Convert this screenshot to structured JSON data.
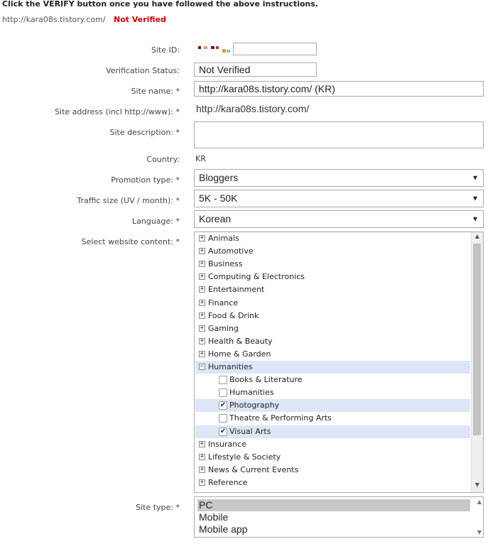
{
  "header": {
    "instruction": "Click the VERIFY button once you have followed the above instructions.",
    "site_url": "http://kara08s.tistory.com/",
    "status": "Not Verified"
  },
  "form": {
    "site_id": {
      "label": "Site ID:",
      "value": ""
    },
    "verification_status": {
      "label": "Verification Status:",
      "value": "Not Verified"
    },
    "site_name": {
      "label": "Site name: *",
      "value": "http://kara08s.tistory.com/ (KR)"
    },
    "site_address": {
      "label": "Site address (incl http://www):  *",
      "value": "http://kara08s.tistory.com/"
    },
    "site_description": {
      "label": "Site description: *",
      "value": ""
    },
    "country": {
      "label": "Country:",
      "value": "KR"
    },
    "promotion_type": {
      "label": "Promotion type: *",
      "value": "Bloggers"
    },
    "traffic_size": {
      "label": "Traffic size (UV / month): *",
      "value": "5K - 50K"
    },
    "language": {
      "label": "Language: *",
      "value": "Korean"
    },
    "website_content": {
      "label": "Select website content: *",
      "rows": [
        {
          "label": "Animals",
          "type": "group",
          "expanded": false
        },
        {
          "label": "Automotive",
          "type": "group",
          "expanded": false
        },
        {
          "label": "Business",
          "type": "group",
          "expanded": false
        },
        {
          "label": "Computing & Electronics",
          "type": "group",
          "expanded": false
        },
        {
          "label": "Entertainment",
          "type": "group",
          "expanded": false
        },
        {
          "label": "Finance",
          "type": "group",
          "expanded": false
        },
        {
          "label": "Food & Drink",
          "type": "group",
          "expanded": false
        },
        {
          "label": "Gaming",
          "type": "group",
          "expanded": false
        },
        {
          "label": "Health & Beauty",
          "type": "group",
          "expanded": false
        },
        {
          "label": "Home & Garden",
          "type": "group",
          "expanded": false
        },
        {
          "label": "Humanities",
          "type": "group",
          "expanded": true,
          "highlighted": true
        },
        {
          "label": "Books & Literature",
          "type": "item",
          "checked": false
        },
        {
          "label": "Humanities",
          "type": "item",
          "checked": false
        },
        {
          "label": "Photography",
          "type": "item",
          "checked": true,
          "highlighted": true
        },
        {
          "label": "Theatre & Performing Arts",
          "type": "item",
          "checked": false
        },
        {
          "label": "Visual Arts",
          "type": "item",
          "checked": true,
          "highlighted": true
        },
        {
          "label": "Insurance",
          "type": "group",
          "expanded": false
        },
        {
          "label": "Lifestyle & Society",
          "type": "group",
          "expanded": false
        },
        {
          "label": "News & Current Events",
          "type": "group",
          "expanded": false
        },
        {
          "label": "Reference",
          "type": "group",
          "expanded": false
        }
      ]
    },
    "site_type": {
      "label": "Site type: *",
      "options": [
        "PC",
        "Mobile",
        "Mobile app"
      ],
      "selected": "PC"
    }
  },
  "icons": {
    "expand": "plus-box-icon",
    "collapse": "minus-box-icon",
    "check": "checkmark-icon",
    "dropdown": "chevron-down-icon"
  }
}
